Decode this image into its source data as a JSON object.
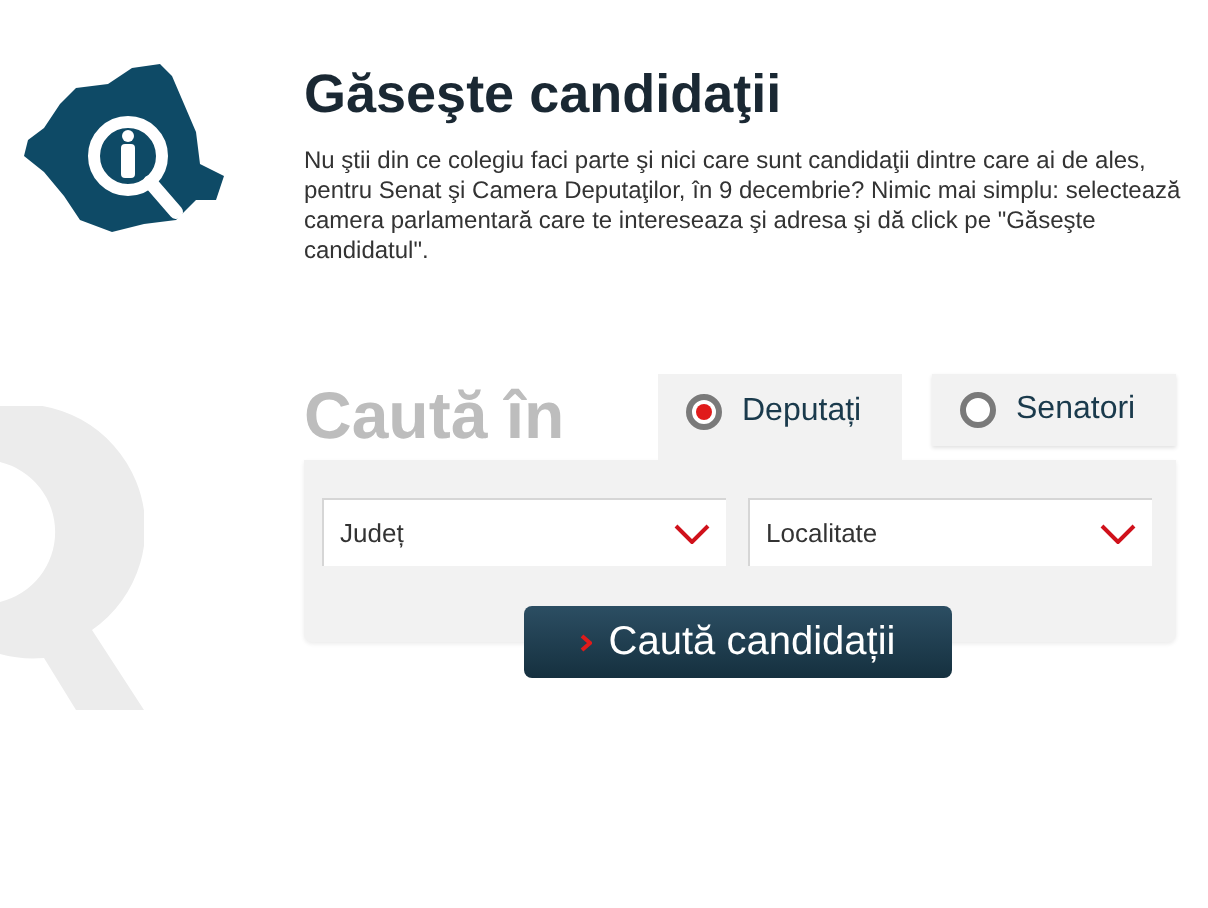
{
  "header": {
    "title": "Găseşte candidaţii",
    "intro": "Nu ştii din ce colegiu faci parte şi nici care sunt candidaţii dintre care ai de ales, pentru Senat şi Camera Deputaţilor, în 9 decembrie? Nimic mai simplu: selectează camera parlamentară care te intereseaza şi adresa şi dă click pe \"Găseşte candidatul\"."
  },
  "search": {
    "heading": "Caută în",
    "tabs": [
      {
        "label": "Deputați",
        "selected": true
      },
      {
        "label": "Senatori",
        "selected": false
      }
    ],
    "dropdowns": [
      {
        "value": "Județ"
      },
      {
        "value": "Localitate"
      }
    ],
    "button": "Caută candidații"
  }
}
